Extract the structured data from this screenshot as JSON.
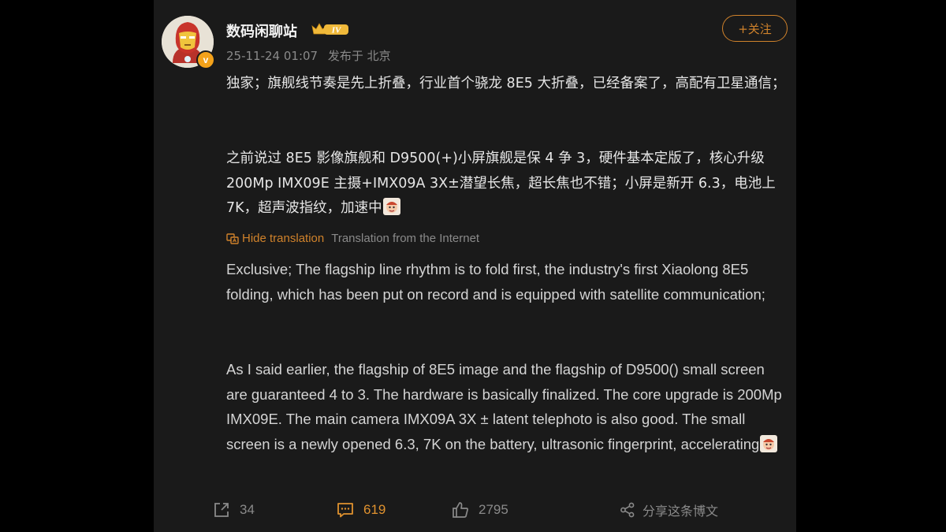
{
  "user": {
    "name": "数码闲聊站",
    "level_badge": "IV",
    "verified_badge": "v",
    "timestamp": "25-11-24 01:07",
    "location": "发布于 北京"
  },
  "follow_label": "+关注",
  "post": {
    "para1": "独家；旗舰线节奏是先上折叠，行业首个骁龙 8E5 大折叠，已经备案了，高配有卫星通信；",
    "para2": "之前说过 8E5 影像旗舰和 D9500(+)小屏旗舰是保 4 争 3，硬件基本定版了，核心升级 200Mp IMX09E 主摄+IMX09A 3X±潜望长焦，超长焦也不错；小屏是新开 6.3，电池上 7K，超声波指纹，加速中"
  },
  "translation": {
    "hide_label": "Hide translation",
    "source_label": "Translation from the Internet",
    "para1": "Exclusive; The flagship line rhythm is to fold first, the industry's first Xiaolong 8E5 folding, which has been put on record and is equipped with satellite communication;",
    "para2": "As I said earlier, the flagship of 8E5 image and the flagship of D9500() small screen are guaranteed 4 to 3. The hardware is basically finalized. The core upgrade is 200Mp IMX09E. The main camera IMX09A 3X ± latent telephoto is also good. The small screen is a newly opened 6.3, 7K on the battery, ultrasonic fingerprint, accelerating"
  },
  "actions": {
    "repost_count": "34",
    "comment_count": "619",
    "like_count": "2795",
    "share_label": "分享这条博文"
  },
  "colors": {
    "accent": "#d0822b",
    "panel_bg": "#1a1a1a",
    "page_bg": "#000000"
  },
  "icons": [
    "repost-icon",
    "comment-icon",
    "like-icon",
    "share-icon",
    "translate-icon",
    "crown-badge-icon",
    "emoji-icon"
  ]
}
